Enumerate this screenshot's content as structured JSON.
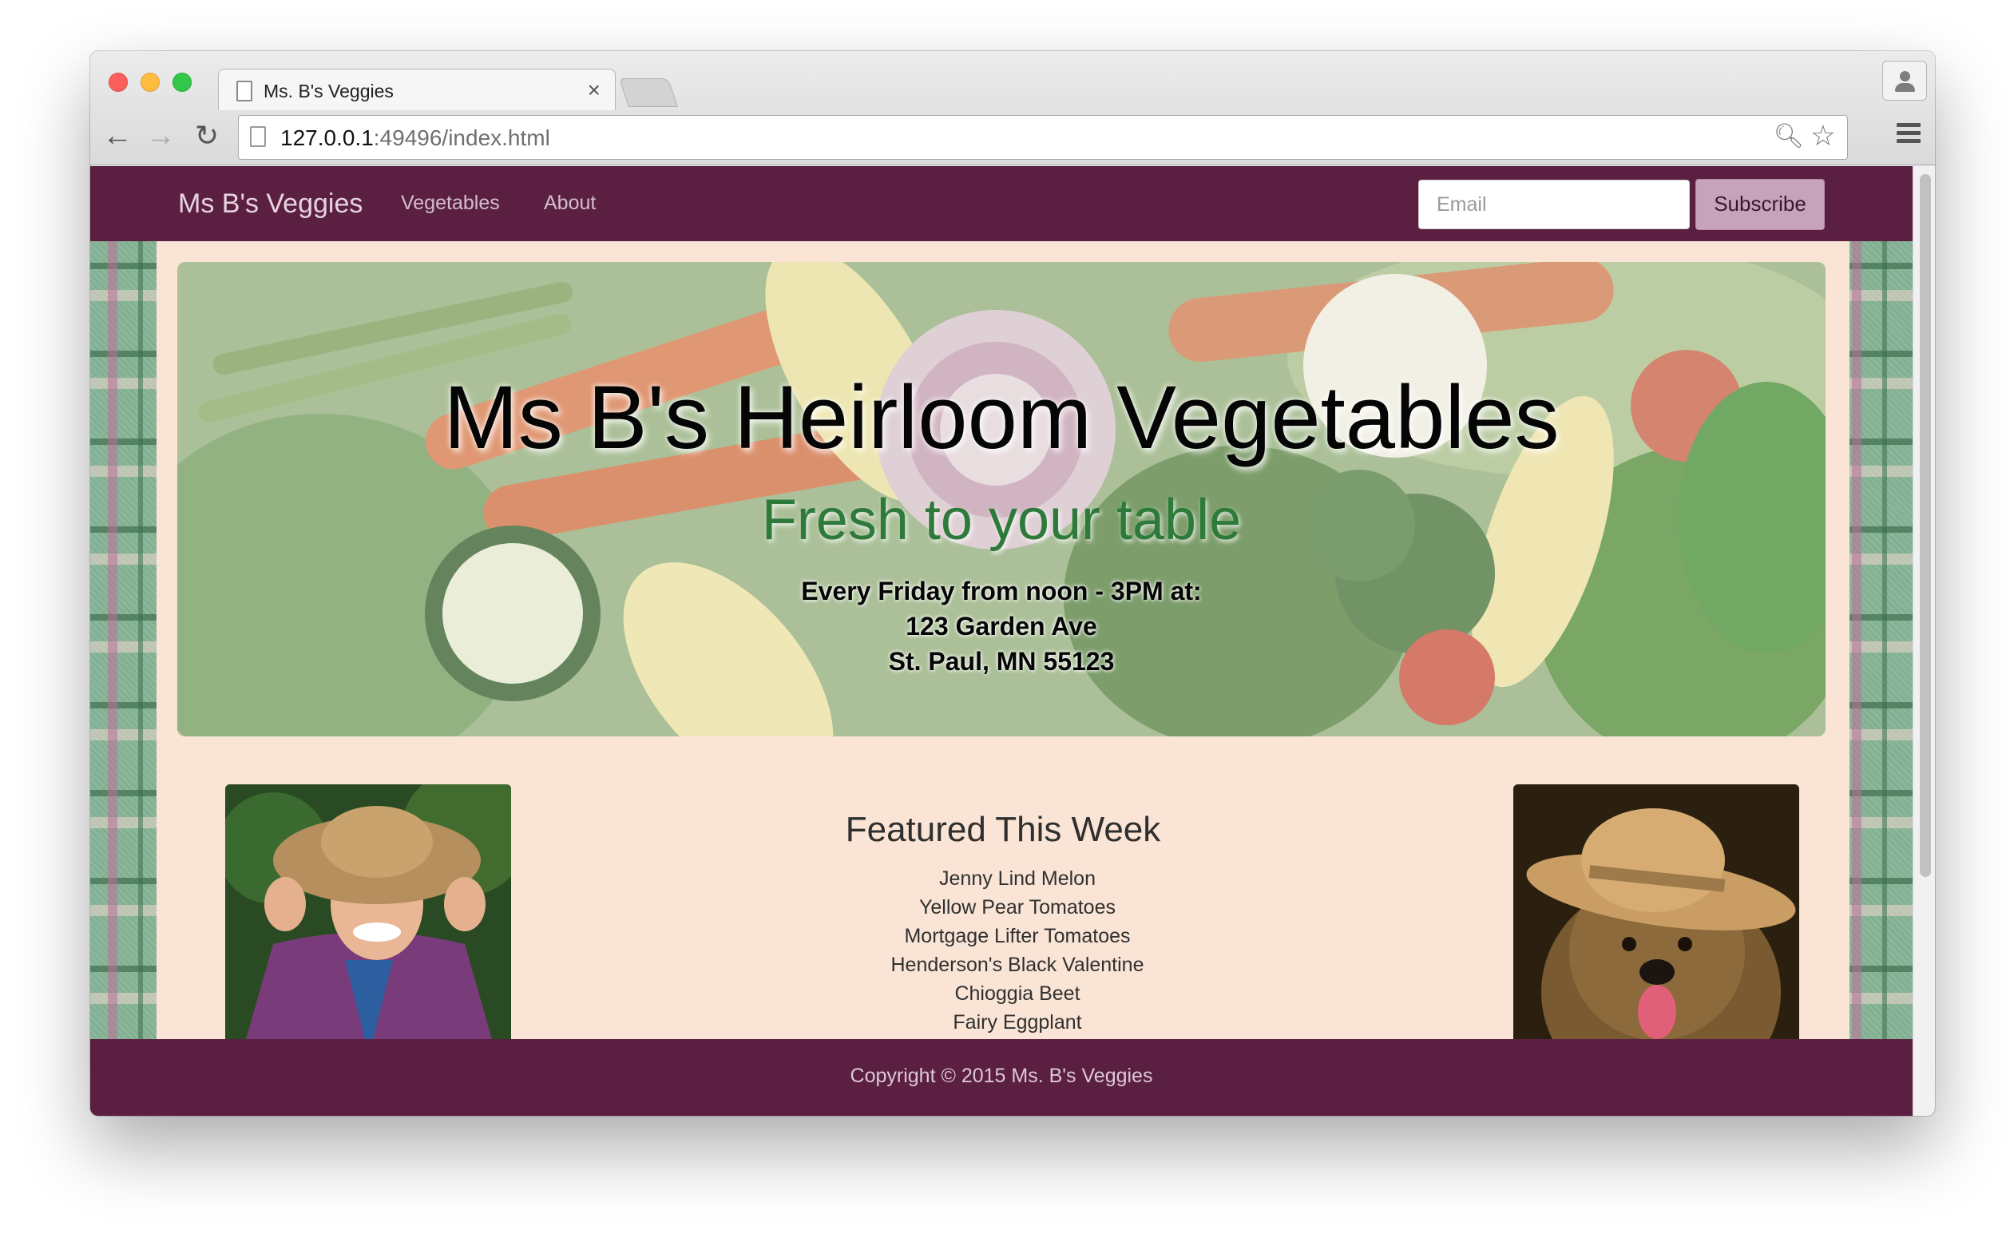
{
  "browser": {
    "tab_title": "Ms. B's Veggies",
    "tab_close": "×",
    "url_host": "127.0.0.1",
    "url_rest": ":49496/index.html"
  },
  "navbar": {
    "brand": "Ms B's Veggies",
    "links": [
      "Vegetables",
      "About"
    ],
    "email_placeholder": "Email",
    "subscribe_label": "Subscribe"
  },
  "hero": {
    "title": "Ms B's Heirloom Vegetables",
    "subtitle": "Fresh to your table",
    "schedule": "Every Friday from noon - 3PM at:",
    "address_line1": "123 Garden Ave",
    "address_line2": "St. Paul, MN 55123"
  },
  "featured": {
    "heading": "Featured This Week",
    "items": [
      "Jenny Lind Melon",
      "Yellow Pear Tomatoes",
      "Mortgage Lifter Tomatoes",
      "Henderson's Black Valentine",
      "Chioggia Beet",
      "Fairy Eggplant"
    ]
  },
  "footer": {
    "copyright": "Copyright © 2015 Ms. B's Veggies"
  },
  "colors": {
    "navbar": "#5b1f42",
    "container": "#fae4d5",
    "subscribe": "#c7a2bb",
    "subtitle": "#2d7a3a"
  }
}
